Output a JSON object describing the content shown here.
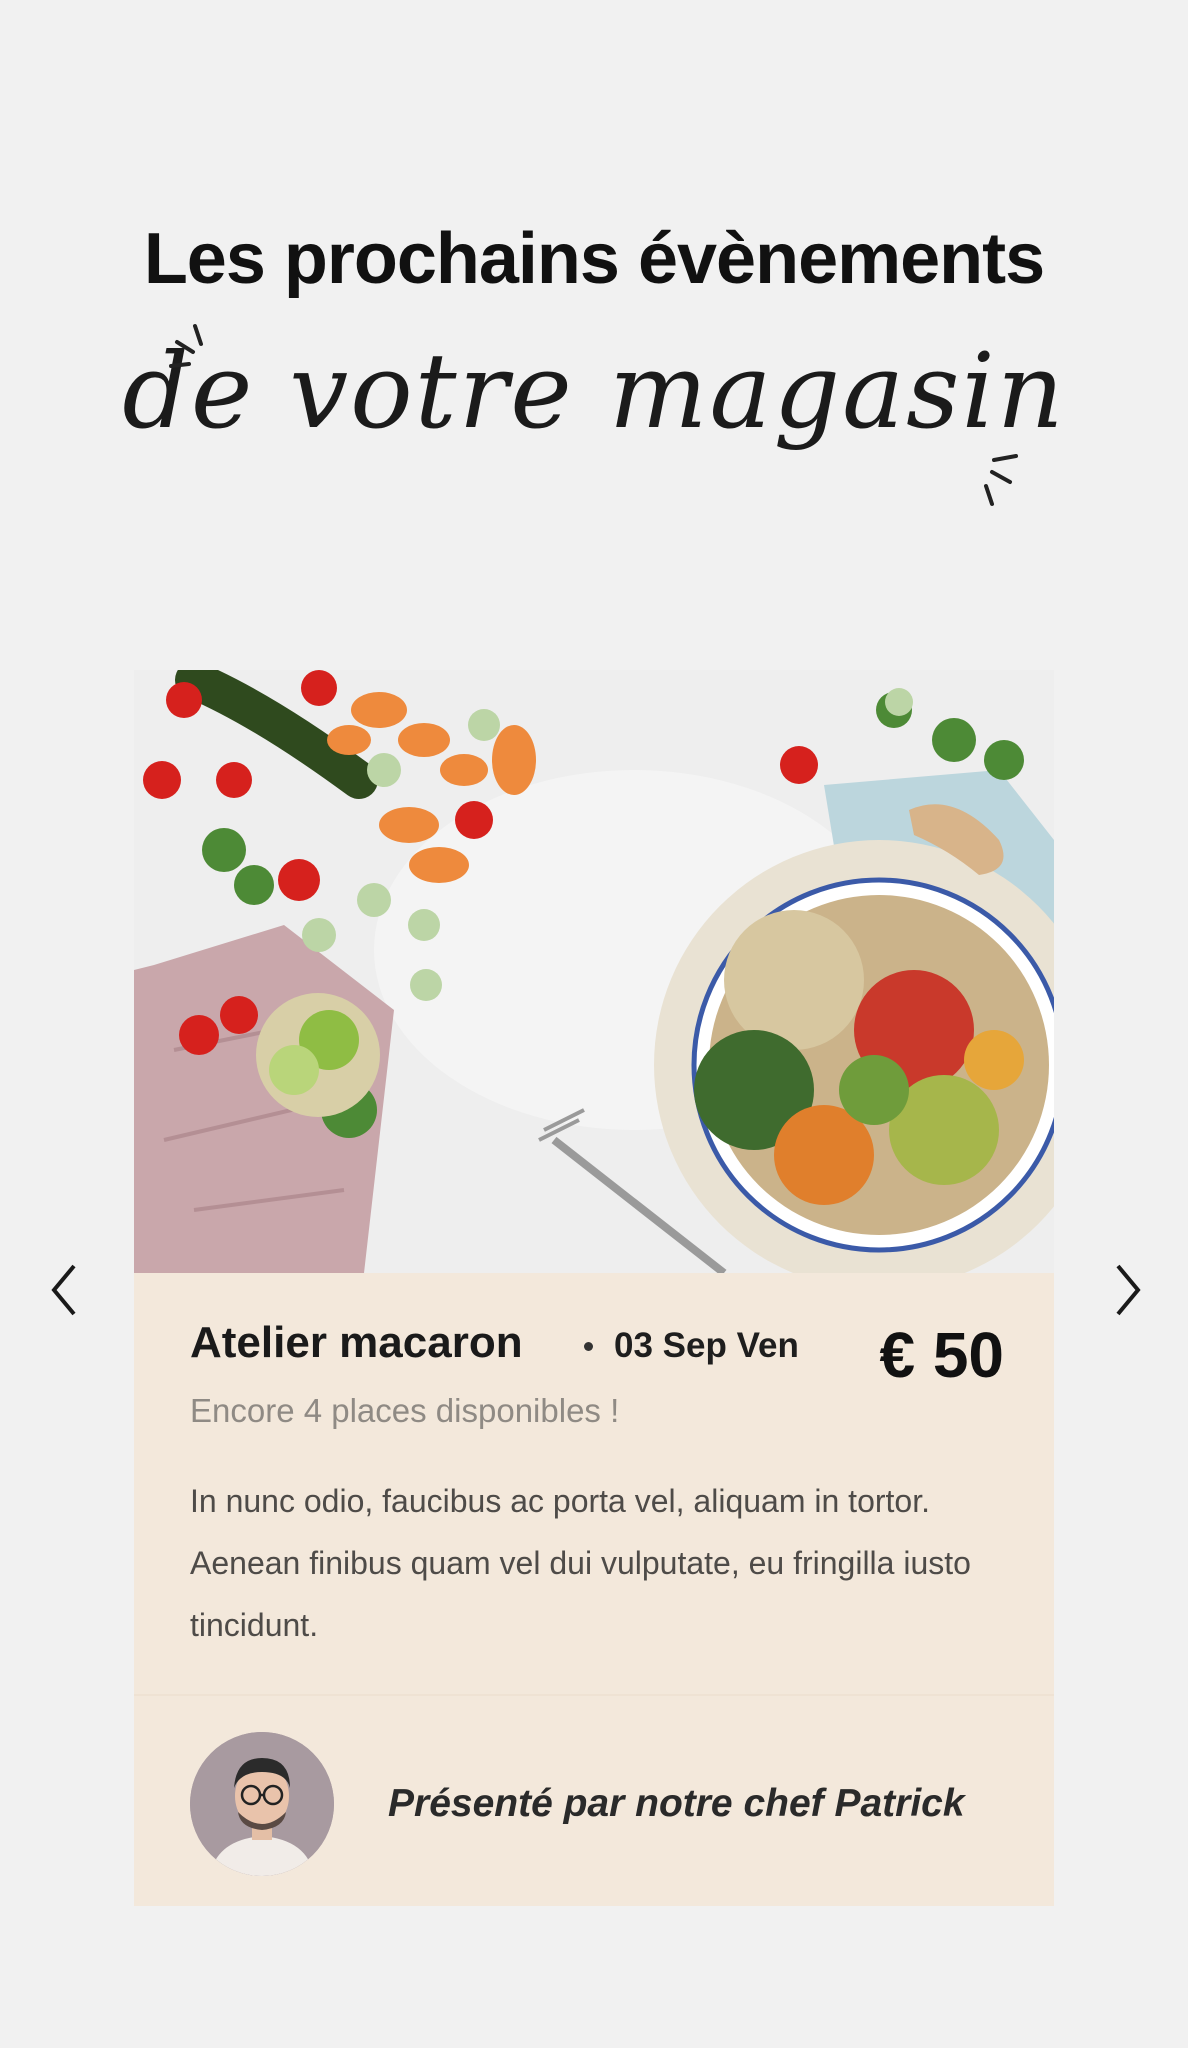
{
  "header": {
    "title": "Les prochains évènements",
    "script_subtitle": "de votre magasin"
  },
  "carousel": {
    "prev_icon": "chevron-left-icon",
    "next_icon": "chevron-right-icon"
  },
  "event": {
    "title": "Atelier macaron",
    "date": "03 Sep Ven",
    "price": "€ 50",
    "availability": "Encore 4 places disponibles !",
    "description": "In nunc odio, faucibus ac porta vel, aliquam in tortor. Aenean finibus quam vel dui vulputate, eu fringilla iusto tincidunt.",
    "presenter": "Présenté par notre chef Patrick"
  },
  "colors": {
    "background": "#f1f1f1",
    "card": "#f3e8db",
    "text": "#1a1a1a",
    "muted": "#8f8a84"
  }
}
